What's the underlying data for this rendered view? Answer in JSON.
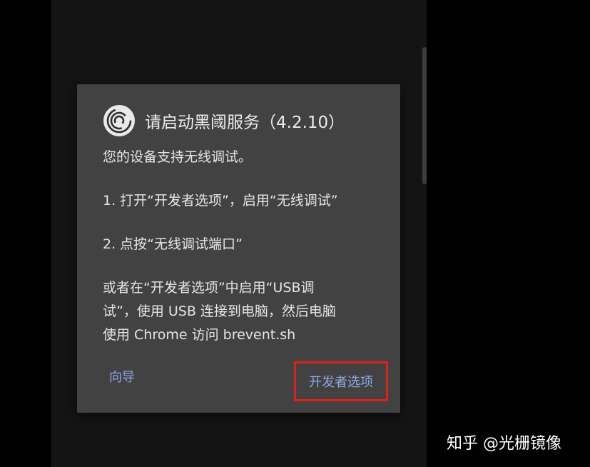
{
  "dialog": {
    "title": "请启动黑阈服务（4.2.10）",
    "icon": "spiral-logo-icon",
    "body": {
      "intro": "您的设备支持无线调试。",
      "step1": "1. 打开“开发者选项”，启用“无线调试”",
      "step2": "2. 点按“无线调试端口”",
      "alt_line1": "或者在“开发者选项”中启用“USB调",
      "alt_line2": "试”，使用 USB 连接到电脑，然后电脑",
      "alt_line3": "使用 Chrome 访问 brevent.sh"
    },
    "actions": {
      "guide_label": "向导",
      "developer_options_label": "开发者选项"
    }
  },
  "watermark": {
    "text": "知乎 @光栅镜像"
  },
  "colors": {
    "dialog_background": "#424242",
    "screen_background": "#141414",
    "button_text": "#8fa7e6",
    "highlight_border": "#e0201c"
  }
}
